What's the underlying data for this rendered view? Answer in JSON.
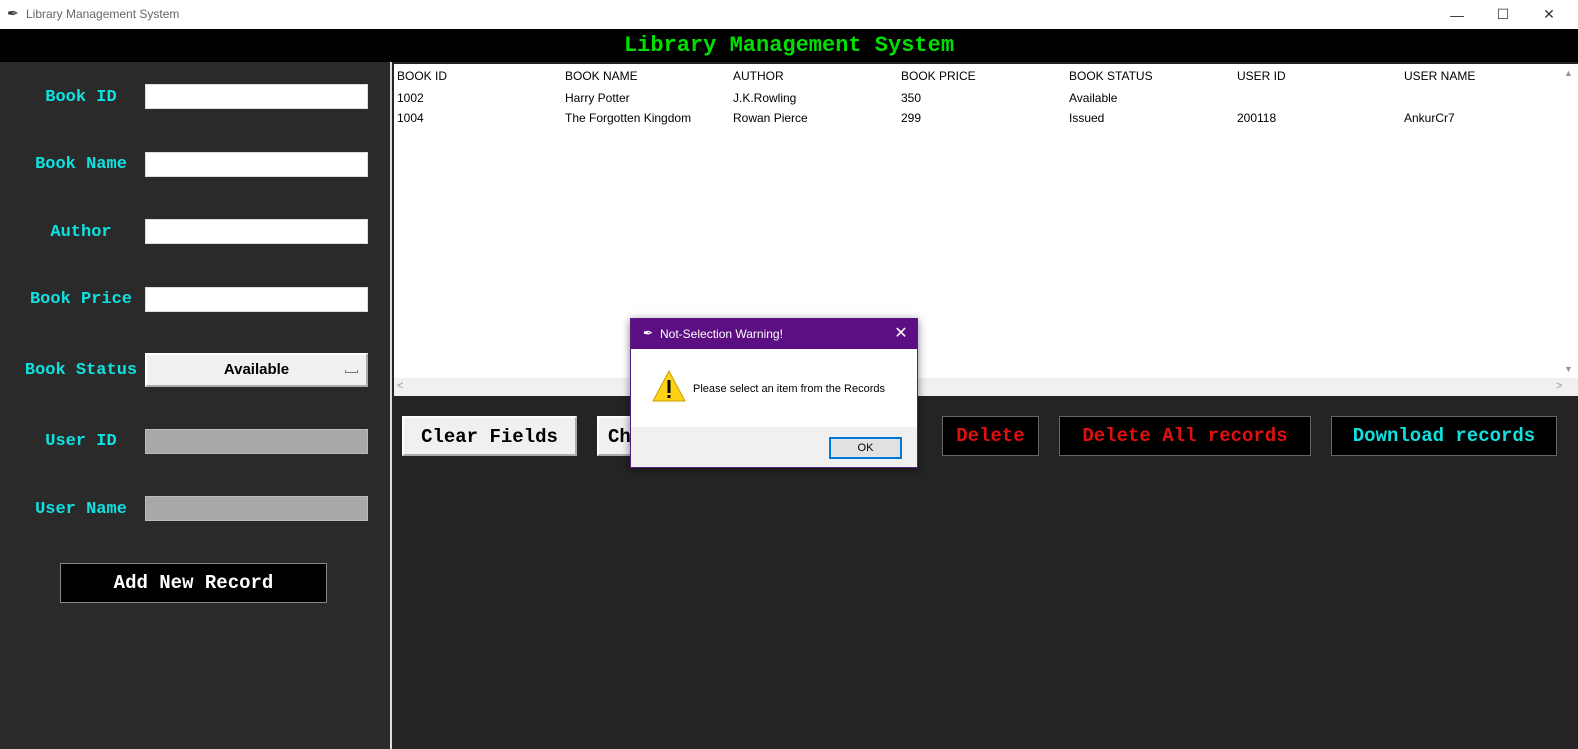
{
  "window": {
    "title": "Library Management System",
    "icon": "feather-icon",
    "controls": {
      "minimize": "—",
      "maximize": "☐",
      "close": "✕"
    }
  },
  "header": {
    "title": "Library Management System",
    "color": "#00e000"
  },
  "form": {
    "book_id_label": "Book ID",
    "book_name_label": "Book Name",
    "author_label": "Author",
    "book_price_label": "Book Price",
    "book_status_label": "Book Status",
    "user_id_label": "User ID",
    "user_name_label": "User Name",
    "book_id_value": "",
    "book_name_value": "",
    "author_value": "",
    "book_price_value": "",
    "book_status_value": "Available",
    "user_id_value": "",
    "user_name_value": "",
    "add_button": "Add New Record",
    "label_color": "#10e0e0"
  },
  "table": {
    "columns": [
      "BOOK ID",
      "BOOK NAME",
      "AUTHOR",
      "BOOK PRICE",
      "BOOK STATUS",
      "USER ID",
      "USER NAME"
    ],
    "rows": [
      [
        "1002",
        "Harry Potter",
        "J.K.Rowling",
        "350",
        "Available",
        "",
        ""
      ],
      [
        "1004",
        "The Forgotten Kingdom",
        "Rowan Pierce",
        "299",
        "Issued",
        "200118",
        "AnkurCr7"
      ]
    ]
  },
  "actions": {
    "clear_fields": "Clear Fields",
    "change": "Ch",
    "delete": "Delete",
    "delete_all": "Delete All records",
    "download": "Download records",
    "danger_color": "#e01010",
    "download_color": "#10e0e0"
  },
  "dialog": {
    "title": "Not-Selection Warning!",
    "message": "Please select an item from the Records",
    "ok": "OK",
    "icon": "warning-icon",
    "title_bg": "#5c0f82"
  }
}
